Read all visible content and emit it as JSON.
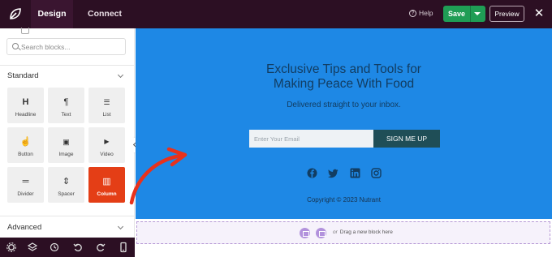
{
  "topbar": {
    "tabs": [
      {
        "label": "Design",
        "active": true
      },
      {
        "label": "Connect",
        "active": false
      }
    ],
    "help_label": "Help",
    "save_label": "Save",
    "preview_label": "Preview",
    "close_glyph": "✕"
  },
  "sidebar": {
    "search_placeholder": "Search blocks...",
    "sections": [
      {
        "title": "Standard",
        "expanded": true
      },
      {
        "title": "Advanced",
        "expanded": false
      }
    ],
    "blocks": [
      {
        "label": "Headline",
        "icon": "H",
        "icon_name": "headline-icon"
      },
      {
        "label": "Text",
        "icon": "¶",
        "icon_name": "paragraph-icon"
      },
      {
        "label": "List",
        "icon": "☰",
        "icon_name": "list-icon"
      },
      {
        "label": "Button",
        "icon": "☝",
        "icon_name": "button-click-icon"
      },
      {
        "label": "Image",
        "icon": "▣",
        "icon_name": "image-icon"
      },
      {
        "label": "Video",
        "icon": "▶",
        "icon_name": "video-icon"
      },
      {
        "label": "Divider",
        "icon": "═",
        "icon_name": "divider-icon"
      },
      {
        "label": "Spacer",
        "icon": "⇕",
        "icon_name": "spacer-icon"
      },
      {
        "label": "Column",
        "icon": "▥",
        "icon_name": "column-icon",
        "highlighted": true
      }
    ],
    "bottom_icons": [
      "settings-icon",
      "layers-icon",
      "history-icon",
      "undo-icon",
      "redo-icon",
      "mobile-preview-icon"
    ]
  },
  "canvas": {
    "title_line1": "Exclusive Tips and Tools for",
    "title_line2": "Making Peace With Food",
    "subtitle": "Delivered straight to your inbox.",
    "email_placeholder": "Enter Your Email",
    "signup_label": "SIGN ME UP",
    "social": [
      "facebook-icon",
      "twitter-icon",
      "linkedin-icon",
      "instagram-icon"
    ],
    "copyright": "Copyright © 2023 Nutrant",
    "new_block_or": "or",
    "new_block_text": "Drag a new block here"
  },
  "colors": {
    "topbar": "#2c0f23",
    "hero": "#1e88e5",
    "save": "#1f9d55",
    "highlight_block": "#e43e16",
    "signup": "#1f4e57",
    "arrow": "#e8321c"
  }
}
